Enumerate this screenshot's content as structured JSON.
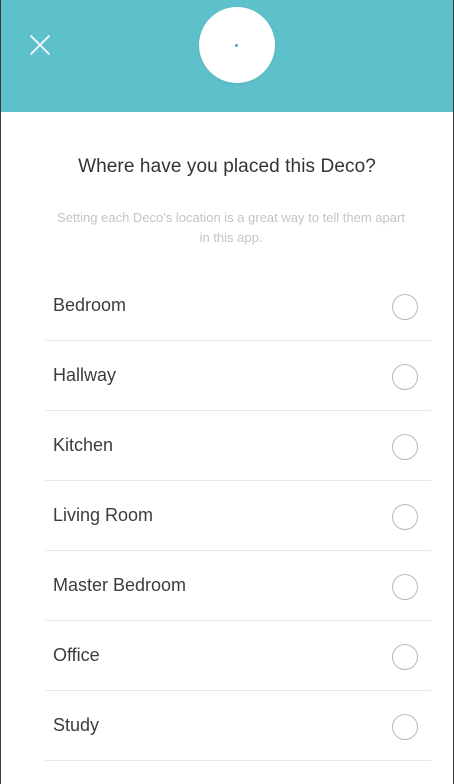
{
  "colors": {
    "header_bg": "#5ec0cb",
    "device_led": "#4aa9c4",
    "radio_border": "#b9b9b9"
  },
  "header": {
    "close_icon": "close-icon",
    "device_icon": "deco-device-icon"
  },
  "title": "Where have you placed this Deco?",
  "subtitle": "Setting each Deco's location is a great way to tell them apart in this app.",
  "locations": [
    {
      "label": "Bedroom",
      "selected": false
    },
    {
      "label": "Hallway",
      "selected": false
    },
    {
      "label": "Kitchen",
      "selected": false
    },
    {
      "label": "Living Room",
      "selected": false
    },
    {
      "label": "Master Bedroom",
      "selected": false
    },
    {
      "label": "Office",
      "selected": false
    },
    {
      "label": "Study",
      "selected": false
    }
  ]
}
